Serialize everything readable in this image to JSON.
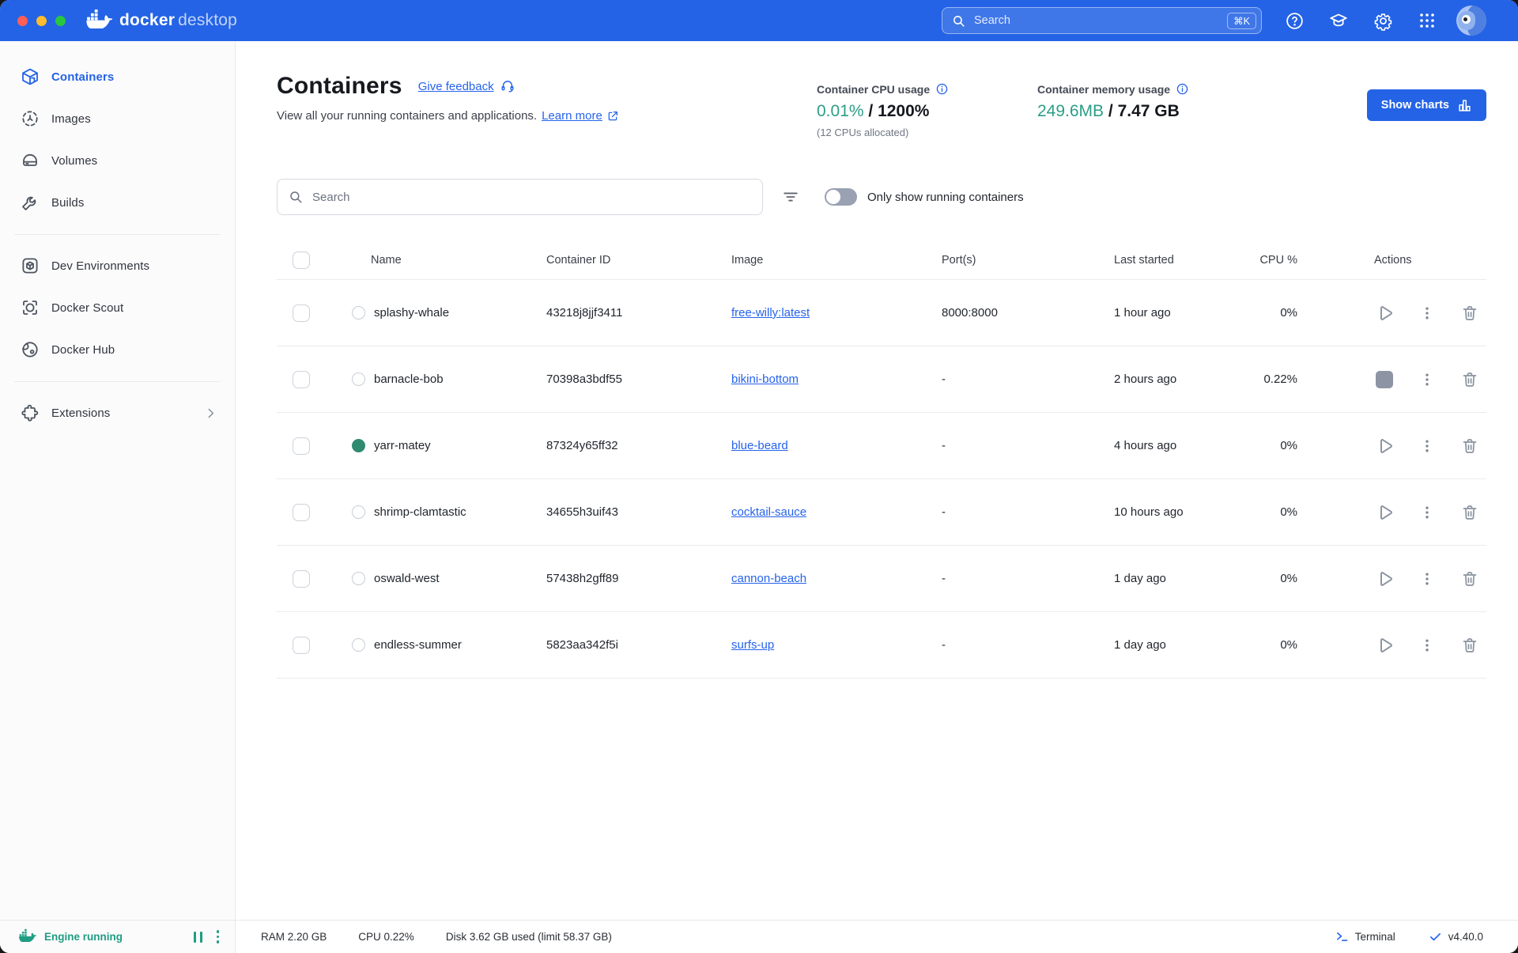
{
  "window": {
    "traffic_lights": [
      "close",
      "minimize",
      "zoom"
    ]
  },
  "topbar": {
    "brand_bold": "docker",
    "brand_light": "desktop",
    "search": {
      "placeholder": "Search",
      "shortcut": "⌘K"
    },
    "icons": [
      "help-icon",
      "learning-center-icon",
      "settings-gear-icon",
      "apps-grid-icon",
      "avatar"
    ]
  },
  "sidebar": {
    "items": [
      {
        "label": "Containers",
        "icon": "containers",
        "group": 0,
        "active": true
      },
      {
        "label": "Images",
        "icon": "images",
        "group": 0
      },
      {
        "label": "Volumes",
        "icon": "volumes",
        "group": 0
      },
      {
        "label": "Builds",
        "icon": "builds",
        "group": 0
      },
      {
        "label": "Dev Environments",
        "icon": "dev-environments",
        "group": 1
      },
      {
        "label": "Docker Scout",
        "icon": "docker-scout",
        "group": 1
      },
      {
        "label": "Docker Hub",
        "icon": "docker-hub",
        "group": 1
      },
      {
        "label": "Extensions",
        "icon": "extensions",
        "group": 2,
        "chevron": true
      }
    ]
  },
  "header": {
    "title": "Containers",
    "feedback_link": "Give feedback",
    "subtitle": "View all your running containers and applications.",
    "learn_more": "Learn more",
    "cpu": {
      "label": "Container CPU usage",
      "used": "0.01%",
      "sep": " / ",
      "total": "1200%",
      "note": "(12 CPUs allocated)"
    },
    "memory": {
      "label": "Container memory usage",
      "used": "249.6MB",
      "sep": " / ",
      "total": "7.47 GB"
    },
    "show_charts_label": "Show charts"
  },
  "filters": {
    "search_placeholder": "Search",
    "toggle_label": "Only show running containers",
    "toggle_state": "off"
  },
  "table": {
    "columns": [
      "Name",
      "Container ID",
      "Image",
      "Port(s)",
      "Last started",
      "CPU %",
      "Actions"
    ],
    "rows": [
      {
        "name": "splashy-whale",
        "id": "43218j8jjf3411",
        "image": "free-willy:latest",
        "ports": "8000:8000",
        "last_started": "1 hour ago",
        "cpu": "0%",
        "running": false,
        "action": "play"
      },
      {
        "name": "barnacle-bob",
        "id": "70398a3bdf55",
        "image": "bikini-bottom",
        "ports": "-",
        "last_started": "2 hours ago",
        "cpu": "0.22%",
        "running": false,
        "action": "stop"
      },
      {
        "name": "yarr-matey",
        "id": "87324y65ff32",
        "image": "blue-beard",
        "ports": "-",
        "last_started": "4 hours ago",
        "cpu": "0%",
        "running": true,
        "action": "play"
      },
      {
        "name": "shrimp-clamtastic",
        "id": "34655h3uif43",
        "image": "cocktail-sauce",
        "ports": "-",
        "last_started": "10 hours ago",
        "cpu": "0%",
        "running": false,
        "action": "play"
      },
      {
        "name": "oswald-west",
        "id": "57438h2gff89",
        "image": "cannon-beach",
        "ports": "-",
        "last_started": "1 day ago",
        "cpu": "0%",
        "running": false,
        "action": "play"
      },
      {
        "name": "endless-summer",
        "id": "5823aa342f5i",
        "image": "surfs-up",
        "ports": "-",
        "last_started": "1 day ago",
        "cpu": "0%",
        "running": false,
        "action": "play"
      }
    ]
  },
  "statusbar": {
    "engine": "Engine running",
    "ram": "RAM 2.20 GB",
    "cpu": "CPU 0.22%",
    "disk": "Disk 3.62 GB used (limit 58.37 GB)",
    "terminal": "Terminal",
    "version": "v4.40.0"
  },
  "colors": {
    "topbar_blue": "#2463e5",
    "accent_blue": "#2563eb",
    "stat_teal": "#2b9e87",
    "running_dot": "#2e8b6f",
    "engine_teal": "#1f9d82",
    "traffic_red": "#fe5f57",
    "traffic_yellow": "#febc2e",
    "traffic_green": "#29c73f"
  }
}
